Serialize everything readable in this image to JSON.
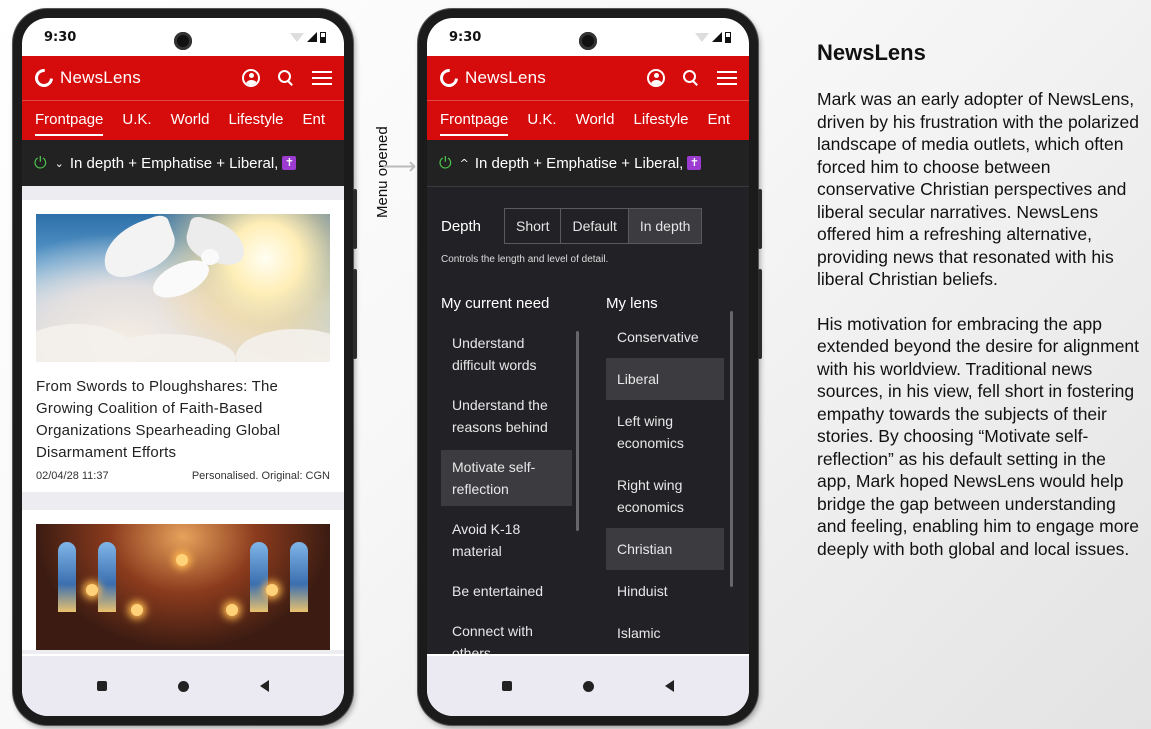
{
  "phone_left": {
    "status": {
      "time": "9:30"
    },
    "app": {
      "title": "NewsLens"
    },
    "tabs": [
      "Frontpage",
      "U.K.",
      "World",
      "Lifestyle",
      "Ent"
    ],
    "filter": {
      "text": "In depth + Emphatise + Liberal,",
      "chevron": "⌄",
      "badge": "✝"
    },
    "articles": [
      {
        "title": "From Swords to Ploughshares: The Growing Coalition of Faith-Based Organizations Spearheading Global Disarmament Efforts",
        "date": "02/04/28 11:37",
        "source": "Personalised. Original: CGN"
      }
    ]
  },
  "annotation": {
    "label": "Menu opened",
    "arrow": "⟶"
  },
  "phone_right": {
    "status": {
      "time": "9:30"
    },
    "app": {
      "title": "NewsLens"
    },
    "tabs": [
      "Frontpage",
      "U.K.",
      "World",
      "Lifestyle",
      "Ent"
    ],
    "filter": {
      "text": "In depth + Emphatise + Liberal,",
      "chevron": "^",
      "badge": "✝"
    },
    "depth": {
      "label": "Depth",
      "options": [
        "Short",
        "Default",
        "In depth"
      ],
      "selected": "In depth",
      "help": "Controls the length and level of detail."
    },
    "needs": {
      "heading": "My current need",
      "items": [
        "Understand difficult words",
        "Understand the reasons behind",
        "Motivate self-reflection",
        "Avoid K-18 material",
        "Be entertained",
        "Connect with others"
      ],
      "selected": "Motivate self-reflection"
    },
    "lens": {
      "heading": "My lens",
      "items": [
        "Conservative",
        "Liberal",
        "Left wing economics",
        "Right wing economics",
        "Christian",
        "Hinduist",
        "Islamic"
      ],
      "selected": [
        "Liberal",
        "Christian"
      ]
    }
  },
  "side_text": {
    "title": "NewsLens",
    "paragraph1": "Mark was an early adopter of NewsLens, driven by his frustration with the polarized landscape of media outlets, which often forced him to choose between conservative Christian perspectives and liberal secular narratives. NewsLens offered him a refreshing alternative, providing news that resonated with his liberal Christian beliefs.",
    "paragraph2": "His motivation for embracing the app extended beyond the desire for alignment with his worldview. Traditional news sources, in his view, fell short in fostering empathy towards the subjects of their stories. By choosing “Motivate self-reflection” as his default setting in the app, Mark hoped NewsLens would help bridge the gap between understanding and feeling, enabling him to engage more deeply with both global and local issues."
  },
  "colors": {
    "brand_red": "#d60b0b",
    "dark_bar": "#222222",
    "power_green": "#4cc24c",
    "badge_purple": "#9c3bd0"
  }
}
